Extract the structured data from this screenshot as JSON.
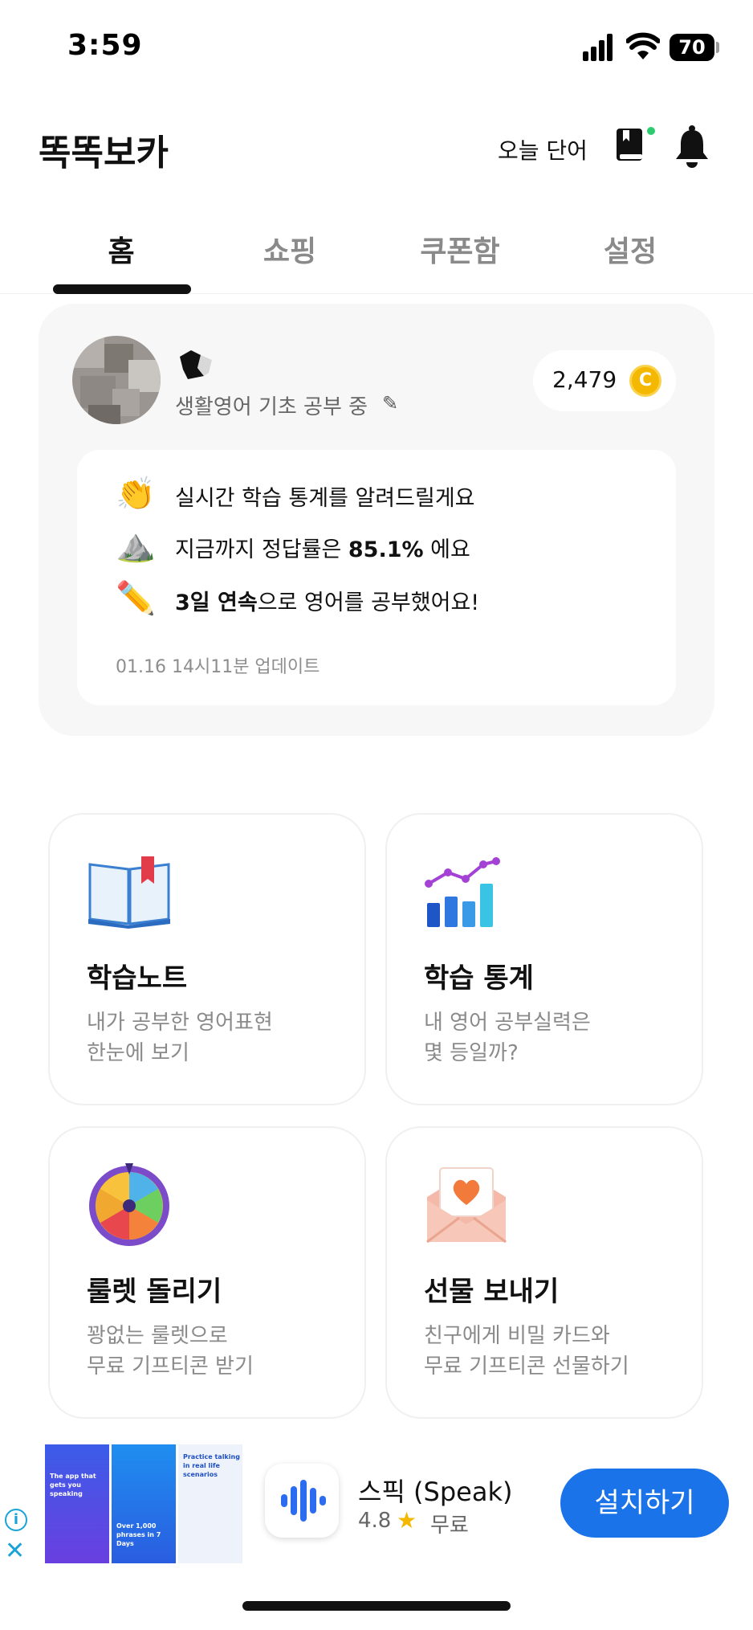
{
  "status_bar": {
    "time": "3:59",
    "battery": "70"
  },
  "header": {
    "app_title": "똑똑보카",
    "today_word_label": "오늘 단어"
  },
  "tabs": [
    {
      "label": "홈",
      "active": true
    },
    {
      "label": "쇼핑",
      "active": false
    },
    {
      "label": "쿠폰함",
      "active": false
    },
    {
      "label": "설정",
      "active": false
    }
  ],
  "profile": {
    "study_status": "생활영어 기초 공부 중",
    "coins": "2,479",
    "coin_symbol": "C"
  },
  "stats": {
    "intro": "실시간 학습 통계를 알려드릴게요",
    "accuracy_prefix": "지금까지 정답률은 ",
    "accuracy_value": "85.1%",
    "accuracy_suffix": " 에요",
    "streak_value": "3일 연속",
    "streak_suffix": "으로 영어를 공부했어요!",
    "updated": "01.16 14시11분 업데이트"
  },
  "features": [
    {
      "title": "학습노트",
      "desc_line1": "내가 공부한 영어표현",
      "desc_line2": "한눈에 보기"
    },
    {
      "title": "학습 통계",
      "desc_line1": "내 영어 공부실력은",
      "desc_line2": "몇 등일까?"
    },
    {
      "title": "룰렛 돌리기",
      "desc_line1": "꽝없는 룰렛으로",
      "desc_line2": "무료 기프티콘 받기"
    },
    {
      "title": "선물 보내기",
      "desc_line1": "친구에게 비밀 카드와",
      "desc_line2": "무료 기프티콘 선물하기"
    }
  ],
  "ad": {
    "shot1_text": "The app that gets you speaking",
    "shot2_text": "Over 1,000 phrases in 7 Days",
    "shot3_text": "Practice talking in real life scenarios",
    "app_name": "스픽 (Speak)",
    "rating": "4.8",
    "price": "무료",
    "install_label": "설치하기"
  },
  "colors": {
    "accent_blue": "#1a73e8",
    "coin_gold": "#f5b800",
    "card_bg": "#f7f7f7"
  }
}
